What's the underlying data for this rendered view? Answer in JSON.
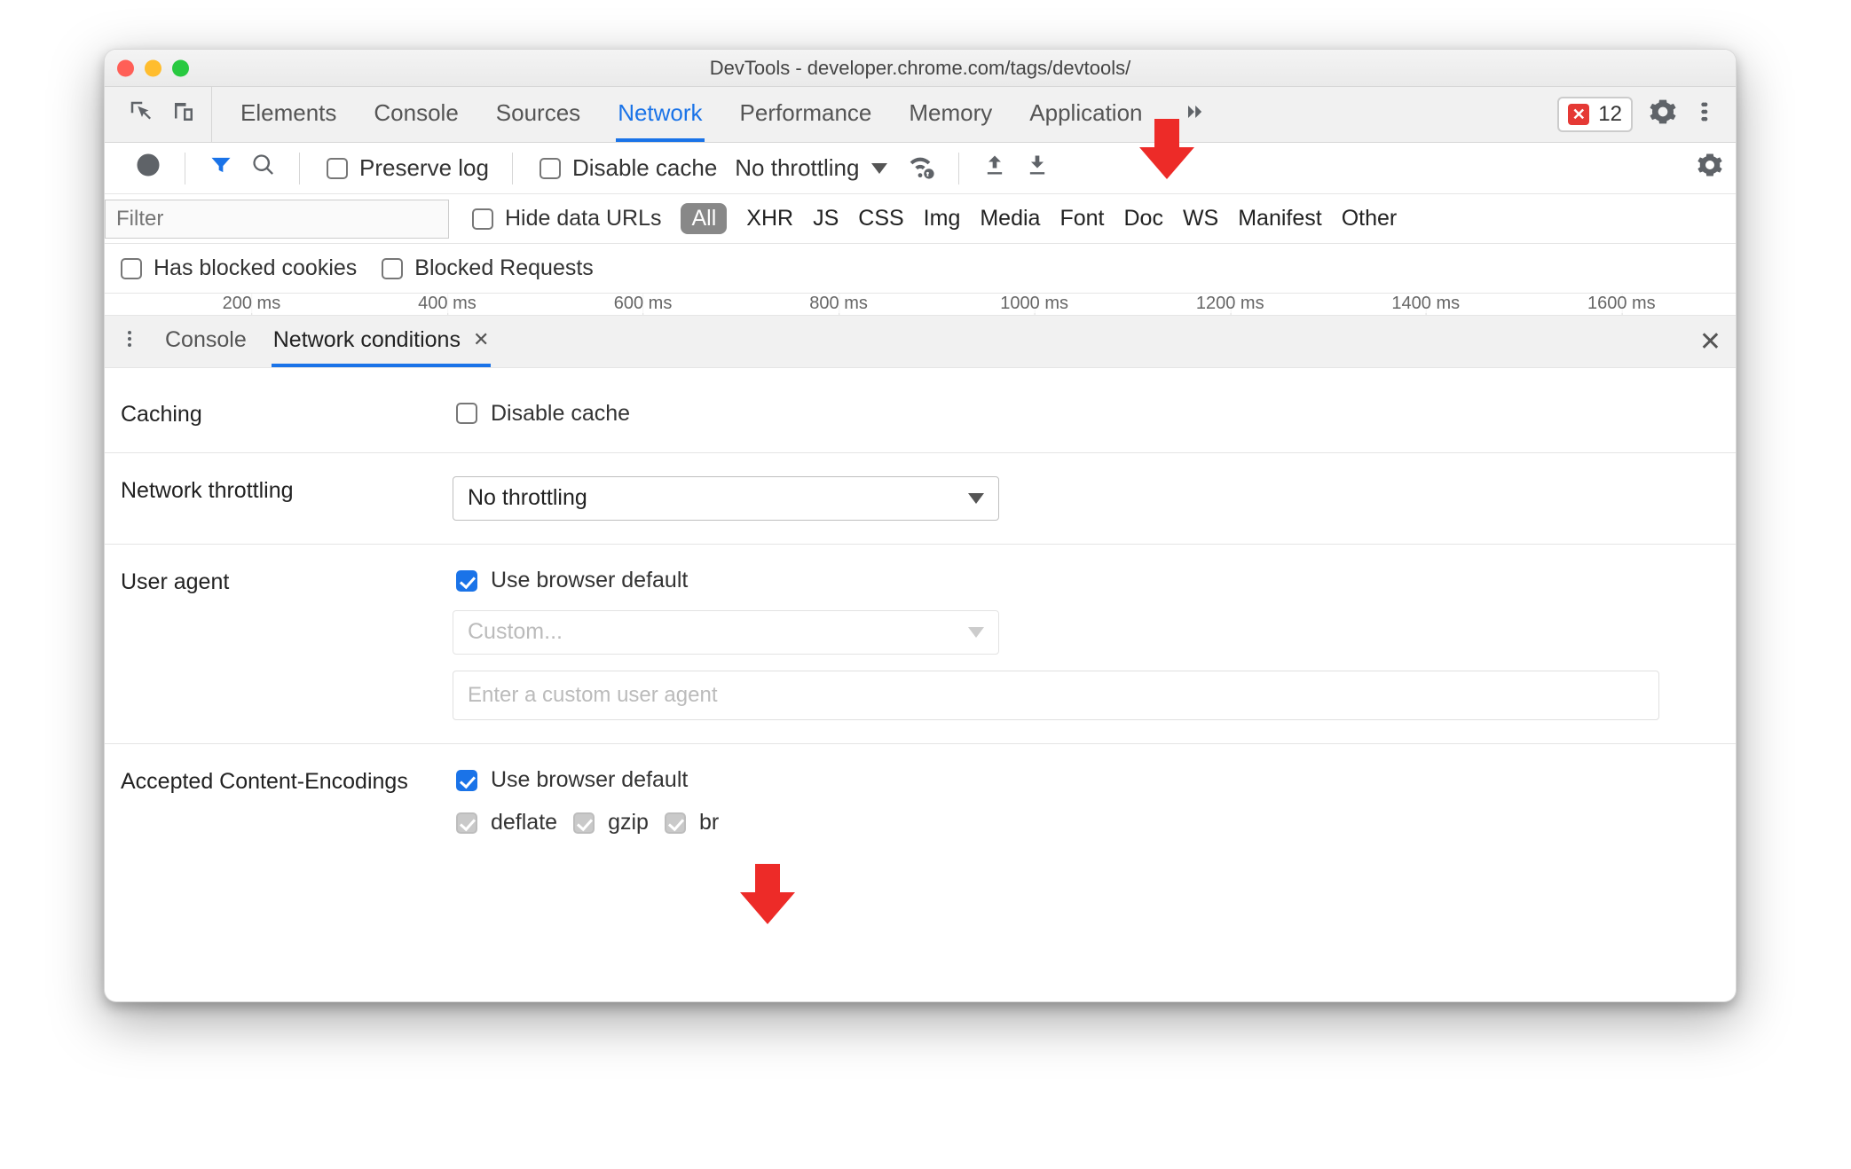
{
  "window": {
    "title": "DevTools - developer.chrome.com/tags/devtools/"
  },
  "tabs": {
    "items": [
      "Elements",
      "Console",
      "Sources",
      "Network",
      "Performance",
      "Memory",
      "Application"
    ],
    "active": "Network",
    "overflow_icon": "double-chevron-right-icon",
    "error_count": "12"
  },
  "toolbar": {
    "preserve_log_label": "Preserve log",
    "disable_cache_label": "Disable cache",
    "throttle_label": "No throttling"
  },
  "filters": {
    "placeholder": "Filter",
    "hide_data_urls_label": "Hide data URLs",
    "all_label": "All",
    "chips": [
      "XHR",
      "JS",
      "CSS",
      "Img",
      "Media",
      "Font",
      "Doc",
      "WS",
      "Manifest",
      "Other"
    ]
  },
  "blocked": {
    "has_blocked_cookies_label": "Has blocked cookies",
    "blocked_requests_label": "Blocked Requests"
  },
  "timeline": {
    "ticks": [
      "200 ms",
      "400 ms",
      "600 ms",
      "800 ms",
      "1000 ms",
      "1200 ms",
      "1400 ms",
      "1600 ms"
    ]
  },
  "drawer": {
    "console_label": "Console",
    "netcond_label": "Network conditions"
  },
  "netcond": {
    "caching_label": "Caching",
    "disable_cache_label": "Disable cache",
    "throttling_label": "Network throttling",
    "throttling_value": "No throttling",
    "user_agent_label": "User agent",
    "use_browser_default_label": "Use browser default",
    "ua_select_placeholder": "Custom...",
    "ua_input_placeholder": "Enter a custom user agent",
    "accepted_encodings_label": "Accepted Content-Encodings",
    "encodings": [
      "deflate",
      "gzip",
      "br"
    ]
  }
}
